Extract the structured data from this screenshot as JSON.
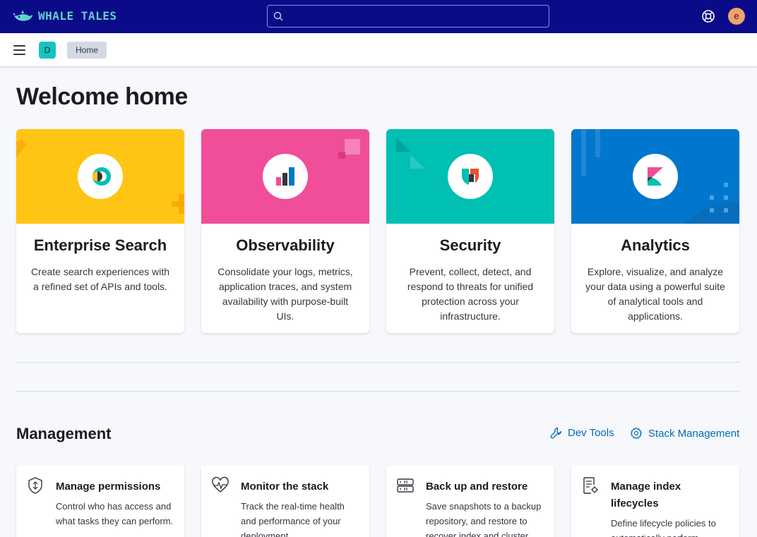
{
  "header": {
    "logo_text": "WHALE TALES",
    "search_placeholder": "",
    "help_icon": "help-icon",
    "user_initial": "e"
  },
  "nav": {
    "space_initial": "D",
    "breadcrumb": "Home"
  },
  "page": {
    "title": "Welcome home"
  },
  "solutions": [
    {
      "title": "Enterprise Search",
      "description": "Create search experiences with a refined set of APIs and tools.",
      "color": "#fec514",
      "icon": "enterprise-search-icon"
    },
    {
      "title": "Observability",
      "description": "Consolidate your logs, metrics, application traces, and system availability with purpose-built UIs.",
      "color": "#f04e98",
      "icon": "observability-icon"
    },
    {
      "title": "Security",
      "description": "Prevent, collect, detect, and respond to threats for unified protection across your infrastructure.",
      "color": "#00bfb3",
      "icon": "security-icon"
    },
    {
      "title": "Analytics",
      "description": "Explore, visualize, and analyze your data using a powerful suite of analytical tools and applications.",
      "color": "#0077cc",
      "icon": "analytics-icon"
    }
  ],
  "management": {
    "title": "Management",
    "links": [
      {
        "label": "Dev Tools",
        "icon": "wrench-icon"
      },
      {
        "label": "Stack Management",
        "icon": "gear-icon"
      }
    ],
    "features": [
      {
        "title": "Manage permissions",
        "description": "Control who has access and what tasks they can perform.",
        "icon": "shield-icon"
      },
      {
        "title": "Monitor the stack",
        "description": "Track the real-time health and performance of your deployment.",
        "icon": "heartbeat-icon"
      },
      {
        "title": "Back up and restore",
        "description": "Save snapshots to a backup repository, and restore to recover index and cluster state.",
        "icon": "storage-icon"
      },
      {
        "title": "Manage index lifecycles",
        "description": "Define lifecycle policies to automatically perform operations as an index ages.",
        "icon": "index-settings-icon"
      }
    ]
  }
}
